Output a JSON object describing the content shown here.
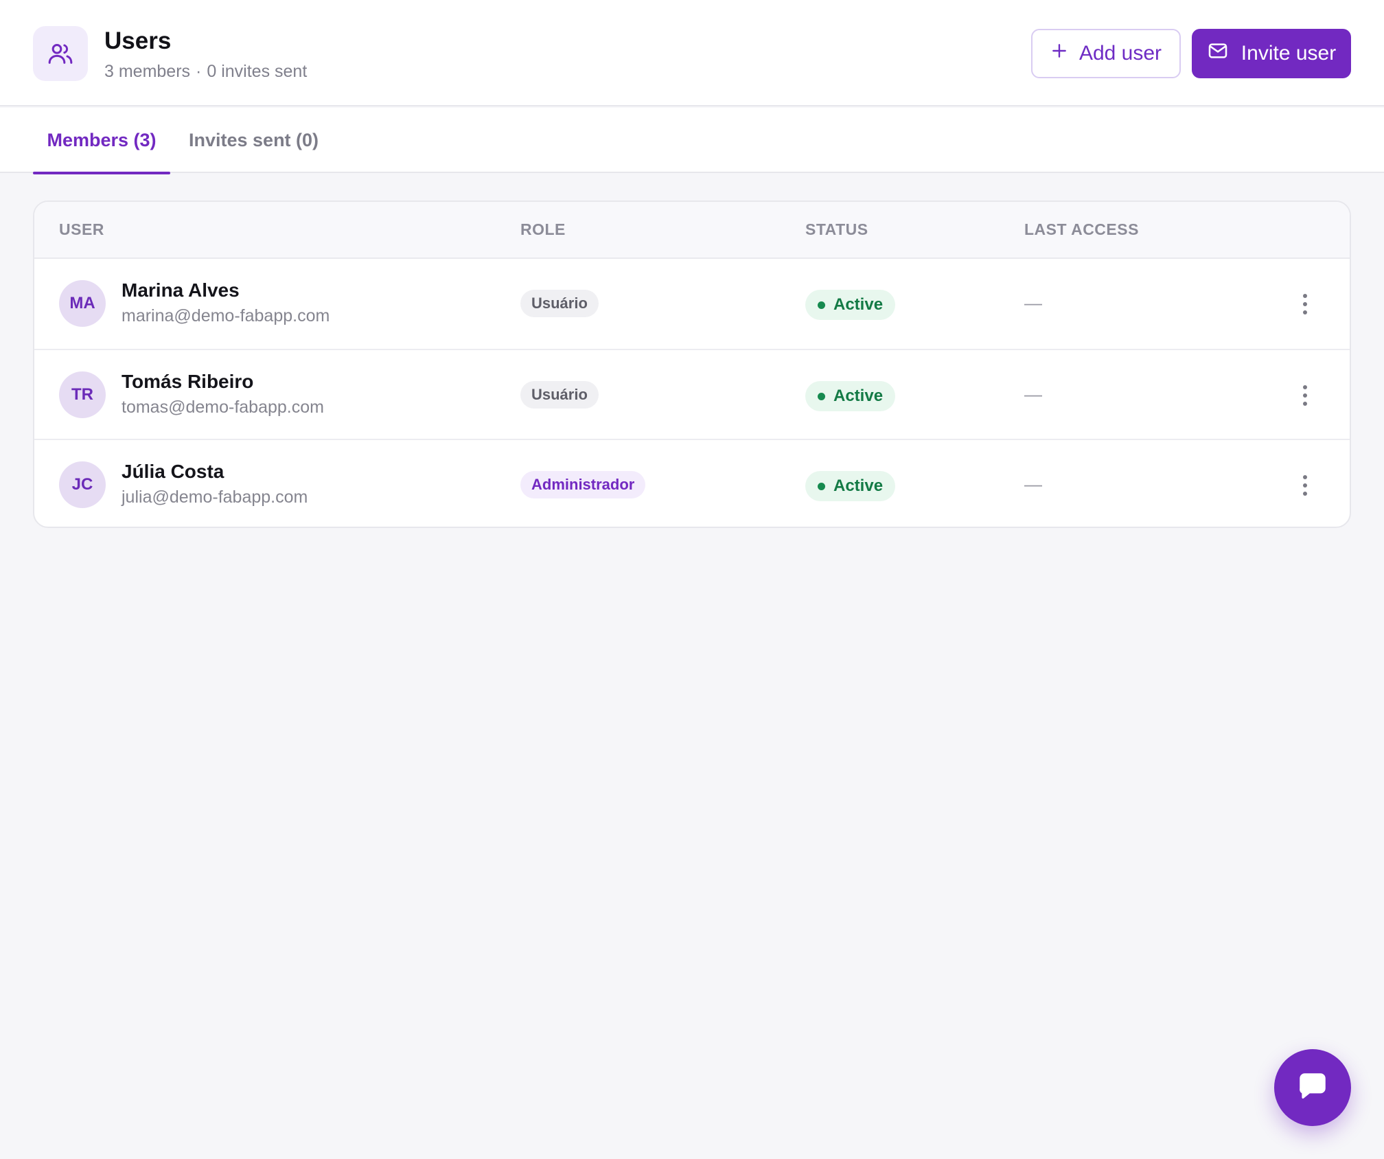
{
  "header": {
    "title": "Users",
    "members_count": "3 members",
    "separator": "·",
    "invites_count": "0 invites sent",
    "icon": "users-icon",
    "add_user_label": "Add user",
    "invite_user_label": "Invite user"
  },
  "tabs": [
    {
      "label": "Members (3)",
      "active": true
    },
    {
      "label": "Invites sent (0)",
      "active": false
    }
  ],
  "table": {
    "columns": [
      "USER",
      "ROLE",
      "STATUS",
      "LAST ACCESS"
    ],
    "rows": [
      {
        "initials": "MA",
        "name": "Marina Alves",
        "email": "marina@demo-fabapp.com",
        "role": "Usuário",
        "status": "Active",
        "last_access": "—"
      },
      {
        "initials": "TR",
        "name": "Tomás Ribeiro",
        "email": "tomas@demo-fabapp.com",
        "role": "Usuário",
        "status": "Active",
        "last_access": "—"
      },
      {
        "initials": "JC",
        "name": "Júlia Costa",
        "email": "julia@demo-fabapp.com",
        "role": "Administrador",
        "status": "Active",
        "last_access": "—"
      }
    ]
  },
  "colors": {
    "accent": "#7229c1",
    "status_active_bg": "#e8f7ee",
    "status_active_text": "#137a45",
    "background": "#f6f6f9"
  },
  "chat": {
    "icon": "chat-bubble-icon"
  }
}
